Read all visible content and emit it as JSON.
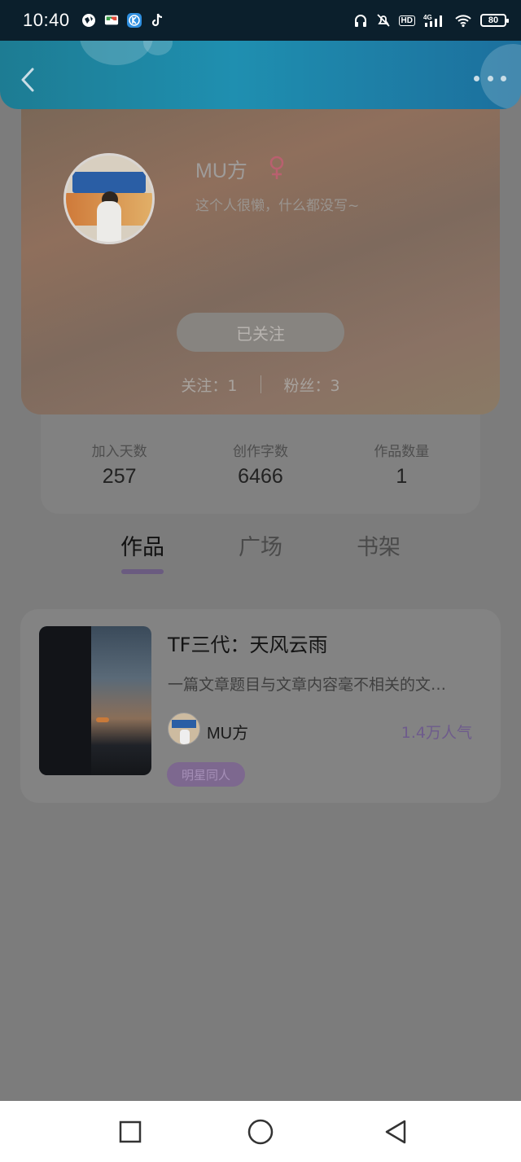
{
  "status_bar": {
    "time": "10:40",
    "left_icons": [
      "browser-icon",
      "video-app-icon",
      "k-app-icon",
      "tiktok-icon"
    ],
    "right_icons": [
      "headphones-icon",
      "do-not-disturb-icon",
      "hd-icon",
      "signal-4g-icon",
      "wifi-icon"
    ],
    "hd_label": "HD",
    "network_label": "4G",
    "battery": "80"
  },
  "header": {
    "back_icon": "chevron-left-icon",
    "more_icon": "more-dots-icon"
  },
  "profile": {
    "username": "MU方",
    "gender_icon": "female-icon",
    "gender_color": "#c0607a",
    "bio": "这个人很懒，什么都没写~",
    "follow_button": "已关注",
    "following_label": "关注：1",
    "followers_label": "粉丝：3"
  },
  "stats": [
    {
      "label": "加入天数",
      "value": "257"
    },
    {
      "label": "创作字数",
      "value": "6466"
    },
    {
      "label": "作品数量",
      "value": "1"
    }
  ],
  "tabs": [
    {
      "label": "作品",
      "active": true
    },
    {
      "label": "广场",
      "active": false
    },
    {
      "label": "书架",
      "active": false
    }
  ],
  "work": {
    "title": "TF三代：天风云雨",
    "description": "一篇文章题目与文章内容毫不相关的文…",
    "author": "MU方",
    "popularity": "1.4万人气",
    "tag": "明星同人",
    "accent_color": "#6e5b8c"
  },
  "nav": {
    "icons": [
      "recents-square-icon",
      "home-circle-icon",
      "back-triangle-icon"
    ]
  }
}
